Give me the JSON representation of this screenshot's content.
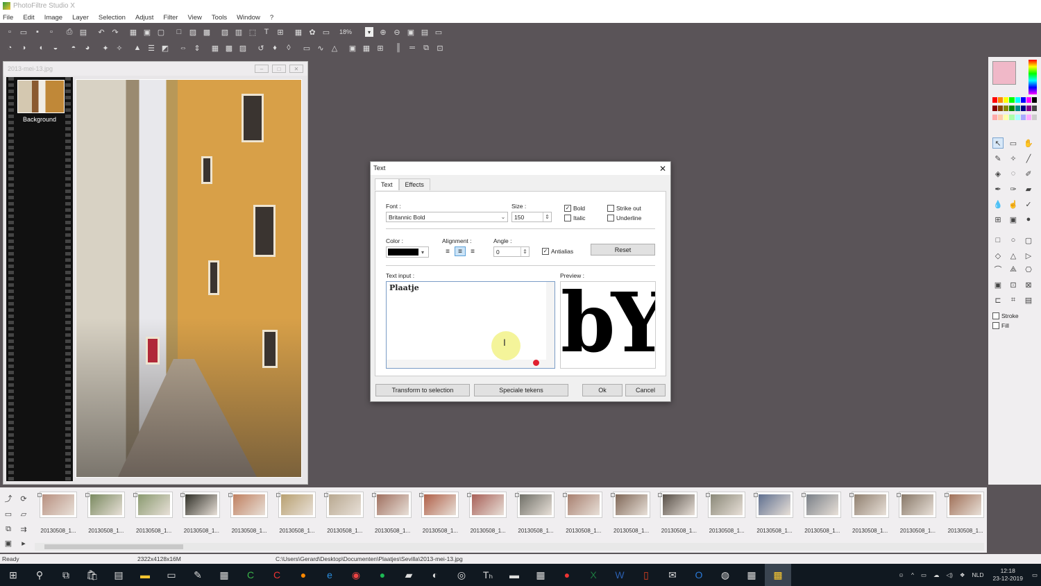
{
  "app": {
    "title": "PhotoFiltre Studio X"
  },
  "menu": [
    "File",
    "Edit",
    "Image",
    "Layer",
    "Selection",
    "Adjust",
    "Filter",
    "View",
    "Tools",
    "Window",
    "?"
  ],
  "toolbar": {
    "zoom": "18%"
  },
  "image_window": {
    "title": "2013-mei-13.jpg",
    "layer_label": "Background"
  },
  "dialog": {
    "title": "Text",
    "tabs": [
      "Text",
      "Effects"
    ],
    "font_label": "Font :",
    "font_value": "Britannic Bold",
    "size_label": "Size :",
    "size_value": "150",
    "bold_label": "Bold",
    "italic_label": "Italic",
    "strikeout_label": "Strike out",
    "underline_label": "Underline",
    "color_label": "Color :",
    "color_value": "#000000",
    "alignment_label": "Alignment :",
    "angle_label": "Angle :",
    "angle_value": "0",
    "antialias_label": "Antialias",
    "reset_label": "Reset",
    "textinput_label": "Text input :",
    "textinput_value": "Plaatje",
    "preview_label": "Preview :",
    "preview_text": "bY",
    "transform_label": "Transform to selection",
    "special_label": "Speciale tekens",
    "ok_label": "Ok",
    "cancel_label": "Cancel"
  },
  "toolpanel": {
    "stroke_label": "Stroke",
    "fill_label": "Fill",
    "fg_color": "#f0b8c8"
  },
  "filmstrip": {
    "thumbs": [
      {
        "cap": "20130508_1...",
        "color": "#b89080"
      },
      {
        "cap": "20130508_1...",
        "color": "#7a8a60"
      },
      {
        "cap": "20130508_1...",
        "color": "#8a9a70"
      },
      {
        "cap": "20130508_1...",
        "color": "#303028"
      },
      {
        "cap": "20130508_1...",
        "color": "#c08060"
      },
      {
        "cap": "20130508_1...",
        "color": "#b8a070"
      },
      {
        "cap": "20130508_1...",
        "color": "#b8a890"
      },
      {
        "cap": "20130508_1...",
        "color": "#a07060"
      },
      {
        "cap": "20130508_1...",
        "color": "#b06048"
      },
      {
        "cap": "20130508_1...",
        "color": "#a86058"
      },
      {
        "cap": "20130508_1...",
        "color": "#707068"
      },
      {
        "cap": "20130508_1...",
        "color": "#a88070"
      },
      {
        "cap": "20130508_1...",
        "color": "#806858"
      },
      {
        "cap": "20130508_1...",
        "color": "#585048"
      },
      {
        "cap": "20130508_1...",
        "color": "#8a8878"
      },
      {
        "cap": "20130508_1...",
        "color": "#607090"
      },
      {
        "cap": "20130508_1...",
        "color": "#7a8088"
      },
      {
        "cap": "20130508_1...",
        "color": "#908070"
      },
      {
        "cap": "20130508_1...",
        "color": "#887868"
      },
      {
        "cap": "20130508_1...",
        "color": "#a07058"
      }
    ]
  },
  "status": {
    "ready": "Ready",
    "dims": "2322x4128x16M",
    "path": "C:\\Users\\Gerard\\Desktop\\Documenten\\Plaatjes\\Sevilla\\2013-mei-13.jpg"
  },
  "taskbar": {
    "lang": "NLD",
    "time": "12:18",
    "date": "23-12-2019"
  }
}
